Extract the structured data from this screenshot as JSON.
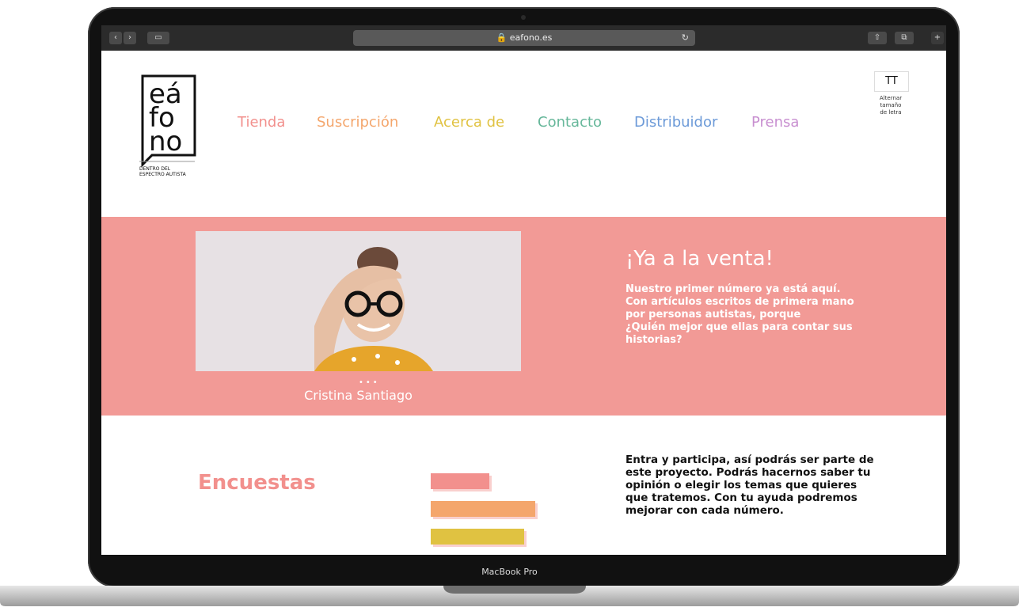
{
  "browser": {
    "url": "eafono.es",
    "back_label": "‹",
    "forward_label": "›",
    "sidebar_label": "▭",
    "share_label": "⇧",
    "tabs_label": "⧉",
    "newtab_label": "+"
  },
  "logo": {
    "wordmark": [
      "eá",
      "fo",
      "no"
    ],
    "tagline": "DENTRO DEL\nESPECTRO AUTISTA"
  },
  "nav": {
    "items": [
      {
        "label": "Tienda",
        "color": "#f2908d"
      },
      {
        "label": "Suscripción",
        "color": "#f4a66c"
      },
      {
        "label": "Acerca de",
        "color": "#e0c241"
      },
      {
        "label": "Contacto",
        "color": "#66b79a"
      },
      {
        "label": "Distribuidor",
        "color": "#6c9ad8"
      },
      {
        "label": "Prensa",
        "color": "#c88fd0"
      }
    ]
  },
  "text_size": {
    "icon_label": "TT",
    "caption": "Alternar\ntamaño\nde letra"
  },
  "hero": {
    "title": "¡Ya a la venta!",
    "body": "Nuestro primer número ya está aquí. Con artículos escritos de primera mano por personas autistas, porque",
    "emphasis": "¿Quién mejor que ellas para contar sus historias?",
    "caption": "Cristina Santiago",
    "background": "#f29a96"
  },
  "section": {
    "title": "Encuestas",
    "body": "Entra y participa, así podrás ser parte de este proyecto. Podrás hacernos saber tu opinión o elegir los temas que quieres que tratemos. Con tu ayuda podremos mejorar con cada número."
  },
  "device": {
    "label": "MacBook Pro"
  },
  "colors": {
    "bar1": "#f2908d",
    "bar2": "#f4a66c",
    "bar3": "#e0c241"
  }
}
